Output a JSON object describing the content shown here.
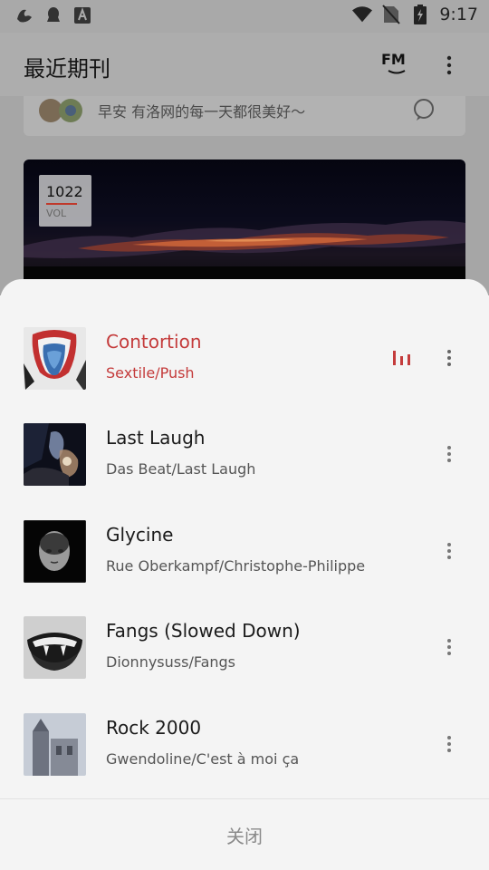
{
  "status_bar": {
    "time": "9:17",
    "icons": [
      "app-notification-icon",
      "qq-icon",
      "a-icon",
      "wifi-icon",
      "no-sim-icon",
      "battery-icon"
    ]
  },
  "app_bar": {
    "title": "最近期刊",
    "fm_label": "FM"
  },
  "background": {
    "message": "早安 有洛网的每一天都很美好〜",
    "volume_number": "1022",
    "volume_label": "VOL"
  },
  "tracks": [
    {
      "title": "Contortion",
      "subtitle": "Sextile/Push",
      "playing": true
    },
    {
      "title": "Last Laugh",
      "subtitle": "Das Beat/Last Laugh",
      "playing": false
    },
    {
      "title": "Glycine",
      "subtitle": "Rue Oberkampf/Christophe-Philippe",
      "playing": false
    },
    {
      "title": "Fangs (Slowed Down)",
      "subtitle": "Dionnysuss/Fangs",
      "playing": false
    },
    {
      "title": "Rock 2000",
      "subtitle": "Gwendoline/C'est à moi ça",
      "playing": false
    }
  ],
  "sheet": {
    "close_label": "关闭"
  },
  "colors": {
    "accent": "#c43b3b",
    "scrim": "#a6a6a6",
    "sheet_bg": "#f4f4f4"
  }
}
